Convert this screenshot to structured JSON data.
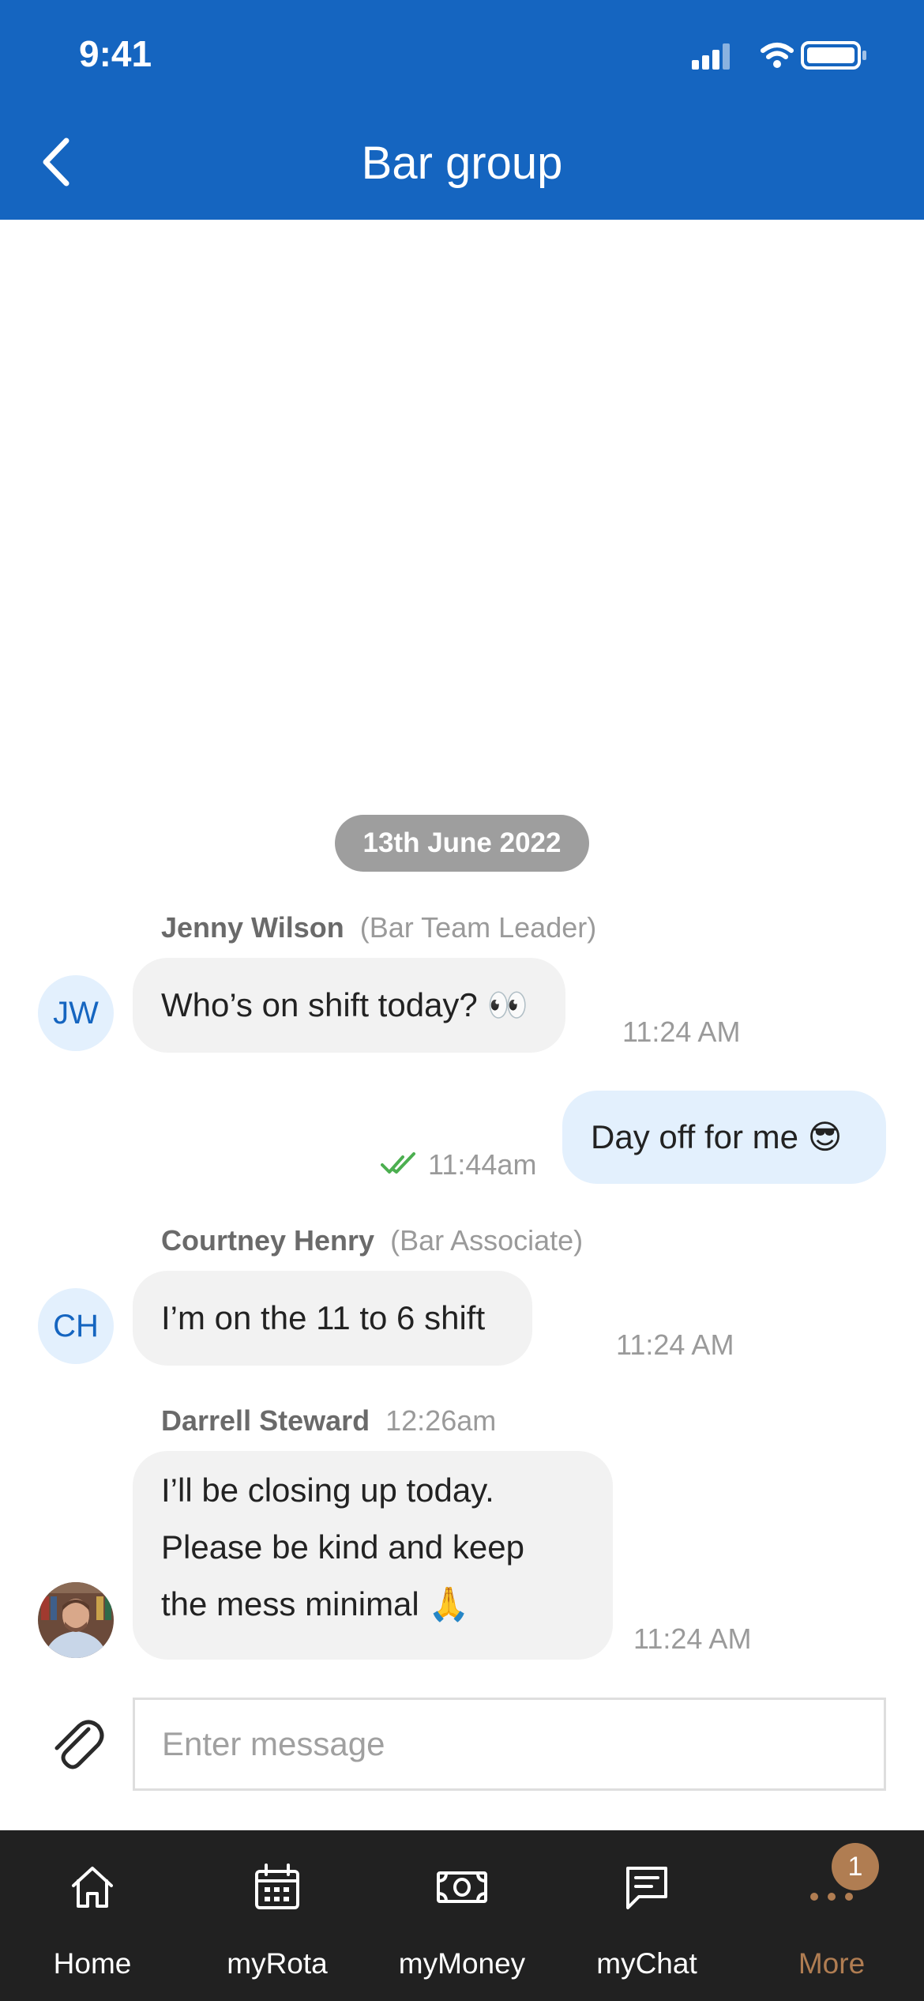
{
  "status_bar": {
    "time": "9:41"
  },
  "header": {
    "title": "Bar group"
  },
  "date_separator": "13th June 2022",
  "messages": [
    {
      "sender": "Jenny Wilson",
      "role": "(Bar Team Leader)",
      "initials": "JW",
      "text": "Who’s on shift today? 👀",
      "time": "11:24 AM"
    },
    {
      "text": "Day off for me 😎",
      "time": "11:44am",
      "status": "read"
    },
    {
      "sender": "Courtney Henry",
      "role": "(Bar Associate)",
      "initials": "CH",
      "text": "I’m on the 11 to 6 shift",
      "time": "11:24 AM"
    },
    {
      "sender": "Darrell Steward",
      "sent_time": "12:26am",
      "lines": [
        "I’ll be closing up today.",
        "Please be kind and keep",
        "the mess minimal 🙏"
      ],
      "time": "11:24 AM"
    }
  ],
  "composer": {
    "placeholder": "Enter message"
  },
  "tabs": [
    {
      "label": "Home",
      "icon": "home-icon"
    },
    {
      "label": "myRota",
      "icon": "calendar-icon"
    },
    {
      "label": "myMoney",
      "icon": "money-icon"
    },
    {
      "label": "myChat",
      "icon": "chat-icon"
    },
    {
      "label": "More",
      "icon": "more-icon",
      "badge": "1"
    }
  ],
  "colors": {
    "header": "#1565c0",
    "tabbar": "#212121",
    "accent_more": "#b07d52",
    "read_check": "#4caf50"
  }
}
